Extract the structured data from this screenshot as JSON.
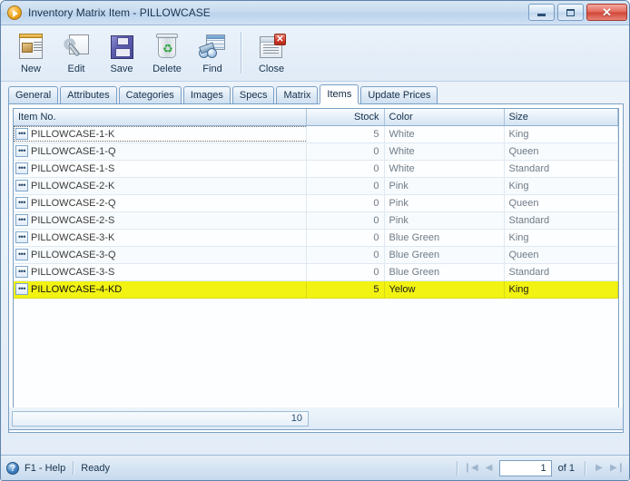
{
  "window": {
    "title": "Inventory Matrix Item - PILLOWCASE",
    "icon": "app-play-icon",
    "controls": {
      "minimize": "minimize-icon",
      "maximize": "maximize-icon",
      "close": "✕"
    }
  },
  "toolbar": {
    "buttons": [
      {
        "label": "New",
        "icon": "new-record-icon"
      },
      {
        "label": "Edit",
        "icon": "edit-wrench-icon"
      },
      {
        "label": "Save",
        "icon": "save-floppy-icon"
      },
      {
        "label": "Delete",
        "icon": "delete-recycle-bin-icon"
      },
      {
        "label": "Find",
        "icon": "find-binoculars-icon"
      },
      {
        "label": "Close",
        "icon": "close-document-icon"
      }
    ]
  },
  "tabs": [
    {
      "label": "General",
      "active": false
    },
    {
      "label": "Attributes",
      "active": false
    },
    {
      "label": "Categories",
      "active": false
    },
    {
      "label": "Images",
      "active": false
    },
    {
      "label": "Specs",
      "active": false
    },
    {
      "label": "Matrix",
      "active": false
    },
    {
      "label": "Items",
      "active": true
    },
    {
      "label": "Update Prices",
      "active": false
    }
  ],
  "grid": {
    "columns": [
      "Item No.",
      "Stock",
      "Color",
      "Size"
    ],
    "ellipsis_button_label": "•••",
    "rows": [
      {
        "item_no": "PILLOWCASE-1-K",
        "stock": "5",
        "color": "White",
        "size": "King",
        "focused": true,
        "highlight": false
      },
      {
        "item_no": "PILLOWCASE-1-Q",
        "stock": "0",
        "color": "White",
        "size": "Queen",
        "focused": false,
        "highlight": false
      },
      {
        "item_no": "PILLOWCASE-1-S",
        "stock": "0",
        "color": "White",
        "size": "Standard",
        "focused": false,
        "highlight": false
      },
      {
        "item_no": "PILLOWCASE-2-K",
        "stock": "0",
        "color": "Pink",
        "size": "King",
        "focused": false,
        "highlight": false
      },
      {
        "item_no": "PILLOWCASE-2-Q",
        "stock": "0",
        "color": "Pink",
        "size": "Queen",
        "focused": false,
        "highlight": false
      },
      {
        "item_no": "PILLOWCASE-2-S",
        "stock": "0",
        "color": "Pink",
        "size": "Standard",
        "focused": false,
        "highlight": false
      },
      {
        "item_no": "PILLOWCASE-3-K",
        "stock": "0",
        "color": "Blue Green",
        "size": "King",
        "focused": false,
        "highlight": false
      },
      {
        "item_no": "PILLOWCASE-3-Q",
        "stock": "0",
        "color": "Blue Green",
        "size": "Queen",
        "focused": false,
        "highlight": false
      },
      {
        "item_no": "PILLOWCASE-3-S",
        "stock": "0",
        "color": "Blue Green",
        "size": "Standard",
        "focused": false,
        "highlight": false
      },
      {
        "item_no": "PILLOWCASE-4-KD",
        "stock": "5",
        "color": "Yelow",
        "size": "King",
        "focused": false,
        "highlight": true
      }
    ],
    "summary": {
      "total_stock": "10"
    },
    "highlight_color": "#f2f312"
  },
  "statusbar": {
    "help_icon": "help-question-icon",
    "help_label": "F1 - Help",
    "status": "Ready",
    "navigation": {
      "first": "❙◀",
      "previous": "◀",
      "page_value": "1",
      "of_label": "of 1",
      "next": "▶",
      "last": "▶❙"
    }
  }
}
